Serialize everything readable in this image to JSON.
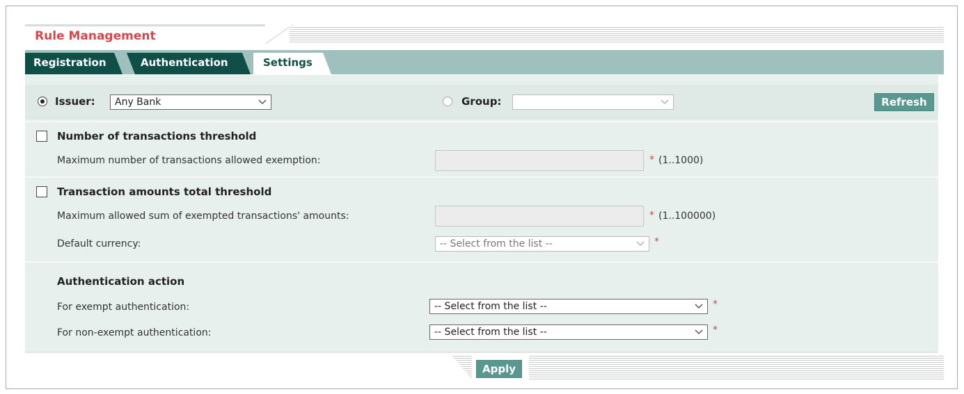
{
  "header": {
    "title": "Rule Management"
  },
  "tabs": [
    {
      "label": "Registration"
    },
    {
      "label": "Authentication"
    },
    {
      "label": "Settings"
    }
  ],
  "issuer_row": {
    "issuer_label": "Issuer:",
    "issuer_value": "Any Bank",
    "group_label": "Group:",
    "group_value": "",
    "refresh_label": "Refresh"
  },
  "tx_count": {
    "title": "Number of transactions threshold",
    "max_label": "Maximum number of transactions allowed exemption:",
    "max_value": "",
    "range": "(1..1000)"
  },
  "tx_amount": {
    "title": "Transaction amounts total threshold",
    "max_label": "Maximum allowed sum of exempted transactions' amounts:",
    "max_value": "",
    "range": "(1..100000)",
    "currency_label": "Default currency:",
    "currency_value": "-- Select from the list --"
  },
  "auth_action": {
    "title": "Authentication action",
    "exempt_label": "For exempt authentication:",
    "exempt_value": "-- Select from the list --",
    "nonexempt_label": "For non-exempt authentication:",
    "nonexempt_value": "-- Select from the list --"
  },
  "required_mark": "*",
  "footer": {
    "apply_label": "Apply"
  },
  "colors": {
    "accent_red": "#d34848",
    "tab_dark": "#0f4f47",
    "tab_strip": "#9fc1bd",
    "button": "#5a9790"
  }
}
